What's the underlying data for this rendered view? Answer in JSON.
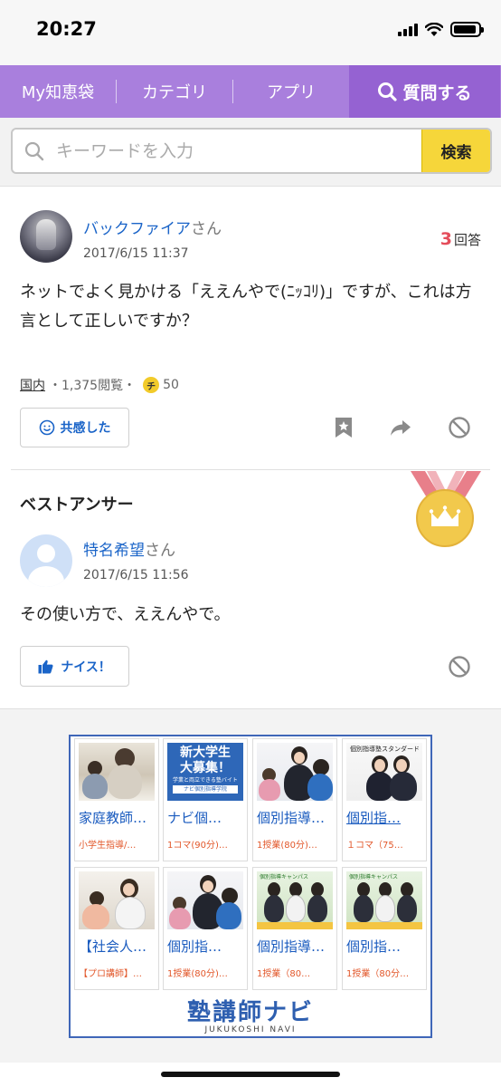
{
  "status": {
    "time": "20:27"
  },
  "nav": {
    "items": [
      "My知恵袋",
      "カテゴリ",
      "アプリ"
    ],
    "ask_label": "質問する"
  },
  "search": {
    "placeholder": "キーワードを入力",
    "button_label": "検索"
  },
  "question": {
    "user_name": "バックファイア",
    "honorific": "さん",
    "date": "2017/6/15 11:37",
    "answer_count": "3",
    "answer_label": "回答",
    "text": "ネットでよく見かける「ええんやで(ﾆｯｺﾘ)」ですが、これは方言として正しいですか？",
    "category": "国内",
    "views": "・1,375閲覧・",
    "coin_label": "チ",
    "coins": "50",
    "empathy_label": "共感した"
  },
  "best_answer": {
    "title": "ベストアンサー",
    "user_name": "特名希望",
    "honorific": "さん",
    "date": "2017/6/15 11:56",
    "text": "その使い方で、ええんやで。",
    "nice_label": "ナイス！"
  },
  "ad": {
    "tiles": [
      {
        "title": "家庭教師…",
        "sub": "小学生指導/…"
      },
      {
        "title": "ナビ個…",
        "sub": "1コマ(90分)…",
        "img_line1": "新大学生",
        "img_line2": "大募集！",
        "img_line3": "学業と両立できる塾バイト",
        "img_line4": "ナビ個別指導学院"
      },
      {
        "title": "個別指導…",
        "sub": "1授業(80分)…"
      },
      {
        "title": "個別指…",
        "sub": "１コマ（75…",
        "img_caption": "個別指導塾スタンダード"
      },
      {
        "title": "【社会人…",
        "sub": "【プロ講師】…"
      },
      {
        "title": "個別指…",
        "sub": "1授業(80分)…"
      },
      {
        "title": "個別指導…",
        "sub": "1授業（80…",
        "img_caption": "個別指導キャンパス"
      },
      {
        "title": "個別指…",
        "sub": "1授業（80分…",
        "img_caption": "個別指導キャンパス"
      }
    ],
    "logo_text": "塾講師ナビ",
    "logo_sub": "JUKUKOSHI NAVI"
  }
}
